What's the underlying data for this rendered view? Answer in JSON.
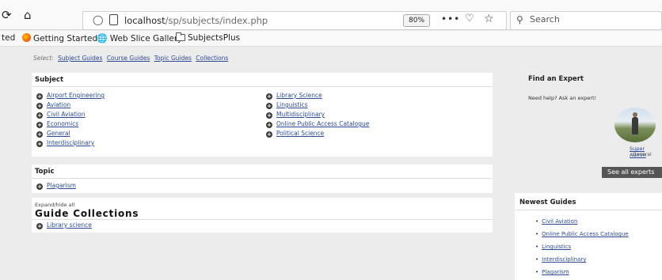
{
  "toolbar": {
    "reload_glyph": "⟳",
    "home_glyph": "⌂",
    "url_host": "localhost",
    "url_path": "/sp/subjects/index.php",
    "zoom": "80%",
    "more_glyph": "•••",
    "search_placeholder": "Search"
  },
  "bookmarks": {
    "items": [
      {
        "label": "ted"
      },
      {
        "label": "Getting Started"
      },
      {
        "label": "Web Slice Gallery"
      },
      {
        "label": "SubjectsPlus"
      }
    ]
  },
  "select_nav": {
    "label": "Select:",
    "links": [
      "Subject Guides",
      "Course Guides",
      "Topic Guides",
      "Collections"
    ]
  },
  "subject": {
    "heading": "Subject",
    "col1": [
      "Airport Engineering",
      "Aviation",
      "Civil Aviation",
      "Economics",
      "General",
      "Interdisciplinary"
    ],
    "col2": [
      "Library Science",
      "Linguistics",
      "Multidisciplinary",
      "Online Public Access Catalogue",
      "Political Science"
    ]
  },
  "topic": {
    "heading": "Topic",
    "items": [
      "Plagarism"
    ]
  },
  "collections": {
    "expand_label": "Expand/hide all",
    "heading": "Guide Collections",
    "items": [
      "Library science"
    ]
  },
  "expert": {
    "heading": "Find an Expert",
    "help_text": "Need help? Ask an expert!",
    "name": "Super Admin",
    "role": "General",
    "see_all_label": "See all experts"
  },
  "newest": {
    "heading": "Newest Guides",
    "items": [
      "Civil Aviation",
      "Online Public Access Catalogue",
      "Linguistics",
      "Interdisciplinary",
      "Plagarism"
    ]
  }
}
